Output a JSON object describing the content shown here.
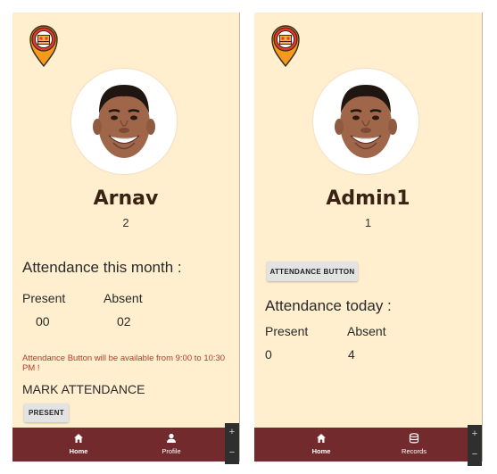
{
  "student_screen": {
    "name": "Arnav",
    "id_number": "2",
    "attendance_heading": "Attendance this month :",
    "present_label": "Present",
    "absent_label": "Absent",
    "present_value": "00",
    "absent_value": "02",
    "availability_notice": "Attendance Button will be available from 9:00 to 10:30 PM !",
    "mark_attendance_label": "MARK ATTENDANCE",
    "present_button": "PRESENT",
    "nav": [
      {
        "label": "Home",
        "icon": "home-icon",
        "active": true
      },
      {
        "label": "Profile",
        "icon": "person-icon",
        "active": false
      }
    ]
  },
  "admin_screen": {
    "name": "Admin1",
    "id_number": "1",
    "attendance_button": "ATTENDANCE BUTTON",
    "attendance_heading": "Attendance today :",
    "present_label": "Present",
    "absent_label": "Absent",
    "present_value": "0",
    "absent_value": "4",
    "nav": [
      {
        "label": "Home",
        "icon": "home-icon",
        "active": true
      },
      {
        "label": "Records",
        "icon": "database-icon",
        "active": false
      }
    ]
  },
  "zoom_controls": {
    "plus": "+",
    "minus": "−"
  },
  "colors": {
    "background": "#ffefcf",
    "tab_bar": "#732a2d",
    "name_text": "#3b2314",
    "warning_text": "#b53a2a",
    "logo_red": "#e8382c",
    "logo_orange": "#f59a1b"
  }
}
